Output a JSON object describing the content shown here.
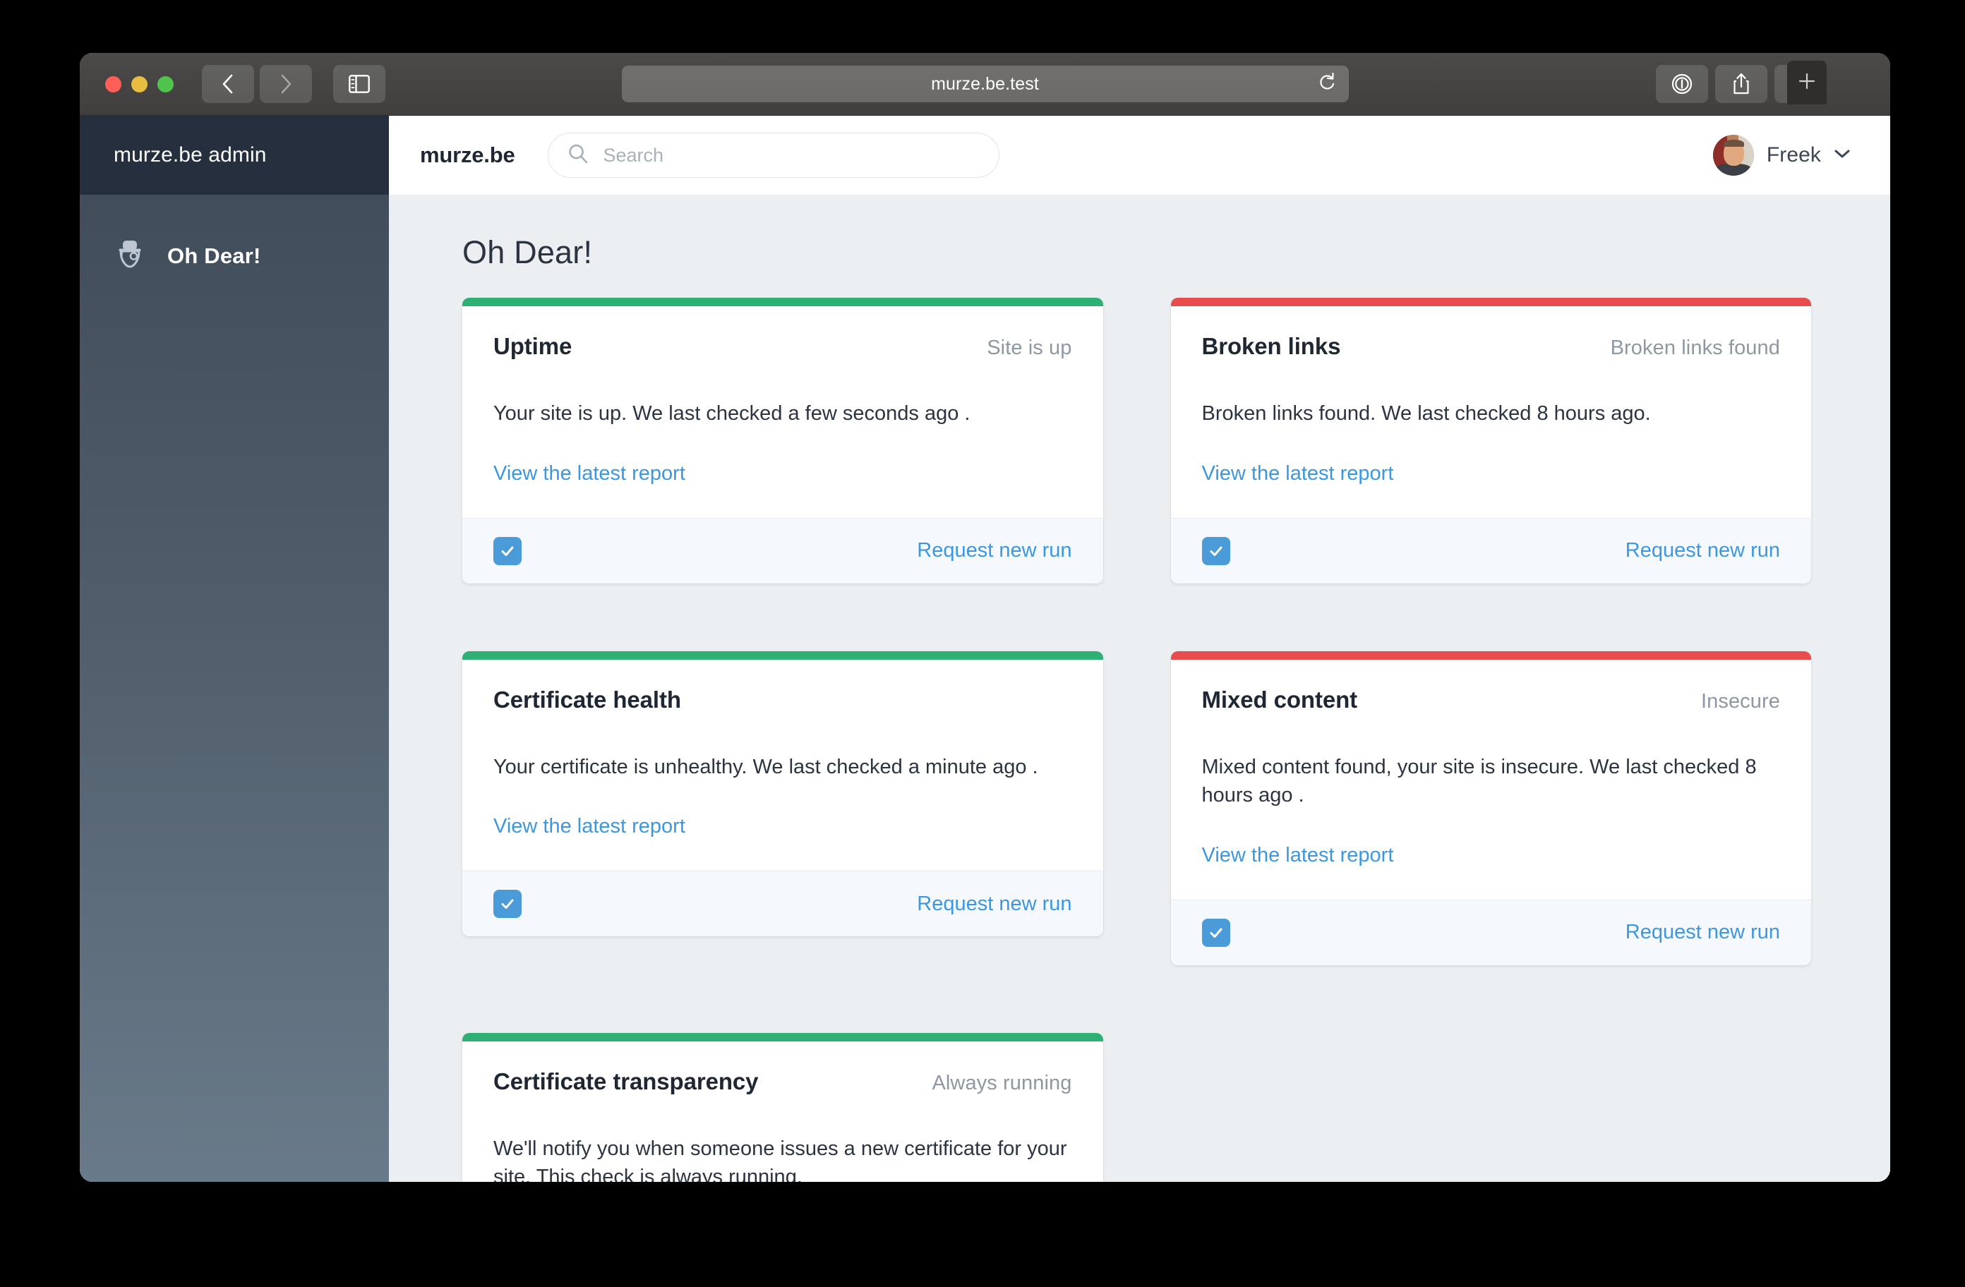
{
  "browser": {
    "url": "murze.be.test",
    "icons": {
      "back": "back-chevron-icon",
      "forward": "forward-chevron-icon",
      "sidebar_toggle": "sidebar-toggle-icon",
      "reload": "reload-icon",
      "password_manager": "onepassword-icon",
      "share": "share-icon",
      "tab_overview": "tab-overview-icon",
      "new_tab": "plus-icon"
    }
  },
  "sidebar": {
    "title": "murze.be admin",
    "items": [
      {
        "label": "Oh Dear!",
        "icon": "oh-dear-logo-icon",
        "active": true
      }
    ]
  },
  "header": {
    "brand": "murze.be",
    "search": {
      "placeholder": "Search",
      "value": "",
      "icon": "search-icon"
    },
    "user": {
      "name": "Freek",
      "avatar": "user-avatar",
      "chevron": "chevron-down-icon"
    }
  },
  "main": {
    "page_title": "Oh Dear!",
    "colors": {
      "success": "#2eb075",
      "danger": "#e84c4c",
      "link": "#3d97e0",
      "checkbox": "#4a9bd8"
    },
    "cards": [
      {
        "title": "Uptime",
        "status": "Site is up",
        "accent": "success",
        "text": "Your site is up. We last checked a few seconds ago .",
        "link": "View the latest report",
        "footer": {
          "checked": true,
          "action": "Request new run"
        }
      },
      {
        "title": "Broken links",
        "status": "Broken links found",
        "accent": "danger",
        "text": "Broken links found. We last checked 8 hours ago.",
        "link": "View the latest report",
        "footer": {
          "checked": true,
          "action": "Request new run"
        }
      },
      {
        "title": "Certificate health",
        "status": "",
        "accent": "success",
        "text": "Your certificate is unhealthy. We last checked a minute ago .",
        "link": "View the latest report",
        "footer": {
          "checked": true,
          "action": "Request new run"
        }
      },
      {
        "title": "Mixed content",
        "status": "Insecure",
        "accent": "danger",
        "text": "Mixed content found, your site is insecure. We last checked 8 hours ago .",
        "link": "View the latest report",
        "footer": {
          "checked": true,
          "action": "Request new run"
        }
      },
      {
        "title": "Certificate transparency",
        "status": "Always running",
        "accent": "success",
        "text": "We'll notify you when someone issues a new certificate for your site. This check is always running.",
        "link": "",
        "footer": null
      }
    ]
  }
}
